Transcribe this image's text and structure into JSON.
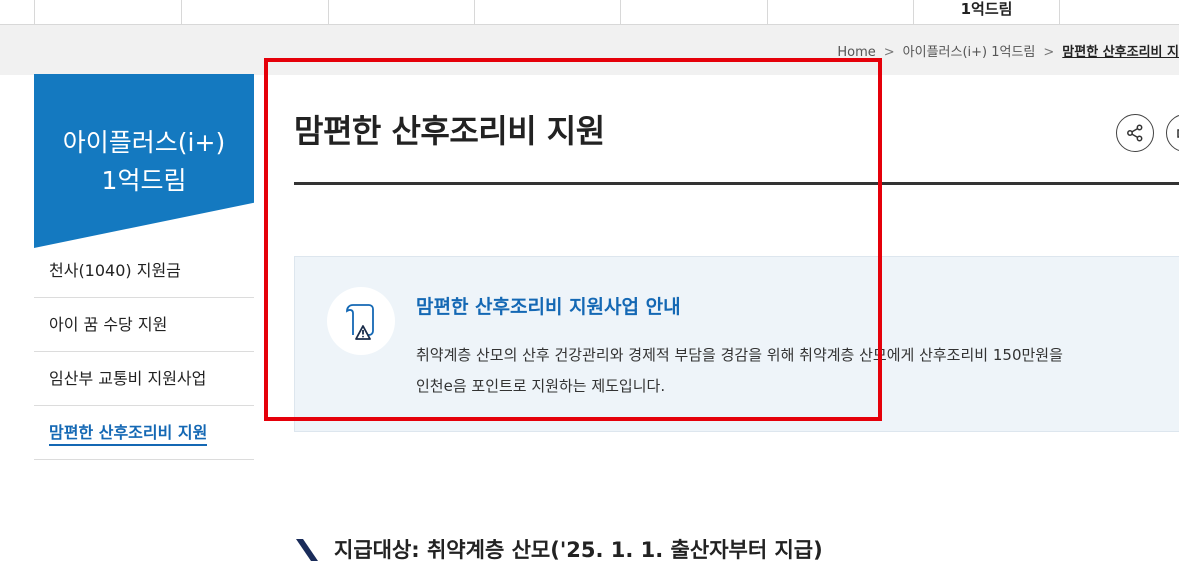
{
  "topnav": {
    "items": [
      "",
      "",
      "",
      "",
      "",
      "",
      "",
      "1억드림",
      ""
    ]
  },
  "breadcrumb": {
    "home": "Home",
    "level1": "아이플러스(i+) 1억드림",
    "current": "맘편한 산후조리비 지"
  },
  "sidebar": {
    "heading_line1": "아이플러스(i+)",
    "heading_line2": "1억드림",
    "items": [
      {
        "label": "천사(1040) 지원금"
      },
      {
        "label": "아이 꿈 수당 지원"
      },
      {
        "label": "임산부 교통비 지원사업"
      },
      {
        "label": "맘편한 산후조리비 지원"
      }
    ]
  },
  "main": {
    "title": "맘편한 산후조리비 지원",
    "info": {
      "title": "맘편한 산후조리비 지원사업 안내",
      "line1": "취약계층 산모의 산후 건강관리와 경제적 부담을 경감을 위해 취약계층 산모에게 산후조리비 150만원을",
      "line2": "인천e음 포인트로 지원하는 제도입니다."
    },
    "section_title": "지급대상: 취약계층 산모('25. 1. 1. 출산자부터 지급)"
  },
  "colors": {
    "brand_blue": "#1479c0",
    "link_blue": "#1468b4",
    "highlight_red": "#e5000a"
  },
  "icons": {
    "share": "share-icon",
    "print": "print-icon",
    "info": "document-warning-icon",
    "section": "slash-mark-icon"
  }
}
